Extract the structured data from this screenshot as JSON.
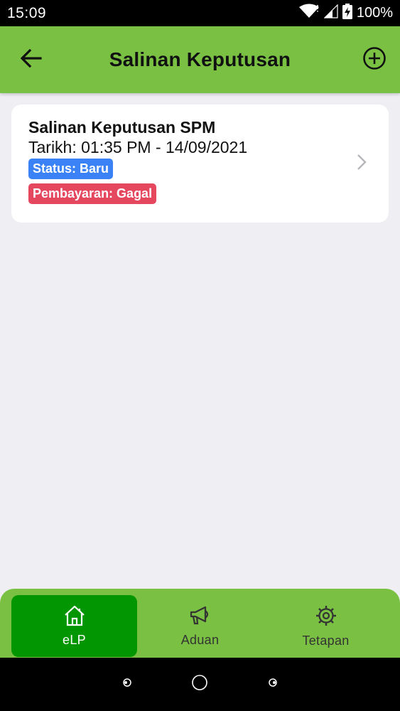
{
  "status_bar": {
    "time": "15:09",
    "battery": "100%"
  },
  "app_bar": {
    "title": "Salinan Keputusan",
    "back_icon": "arrow-left-icon",
    "add_icon": "plus-circle-icon"
  },
  "records": [
    {
      "title": "Salinan Keputusan SPM",
      "date": "Tarikh: 01:35 PM - 14/09/2021",
      "status": "Status: Baru",
      "payment": "Pembayaran: Gagal"
    }
  ],
  "bottom_nav": {
    "items": [
      {
        "label": "eLP",
        "icon": "home-icon",
        "active": true
      },
      {
        "label": "Aduan",
        "icon": "megaphone-icon",
        "active": false
      },
      {
        "label": "Tetapan",
        "icon": "gear-icon",
        "active": false
      }
    ]
  },
  "colors": {
    "app_bar": "#7ac143",
    "nav_active": "#029602",
    "badge_status": "#3b82f6",
    "badge_payment": "#e5475f",
    "background": "#efeef3"
  }
}
